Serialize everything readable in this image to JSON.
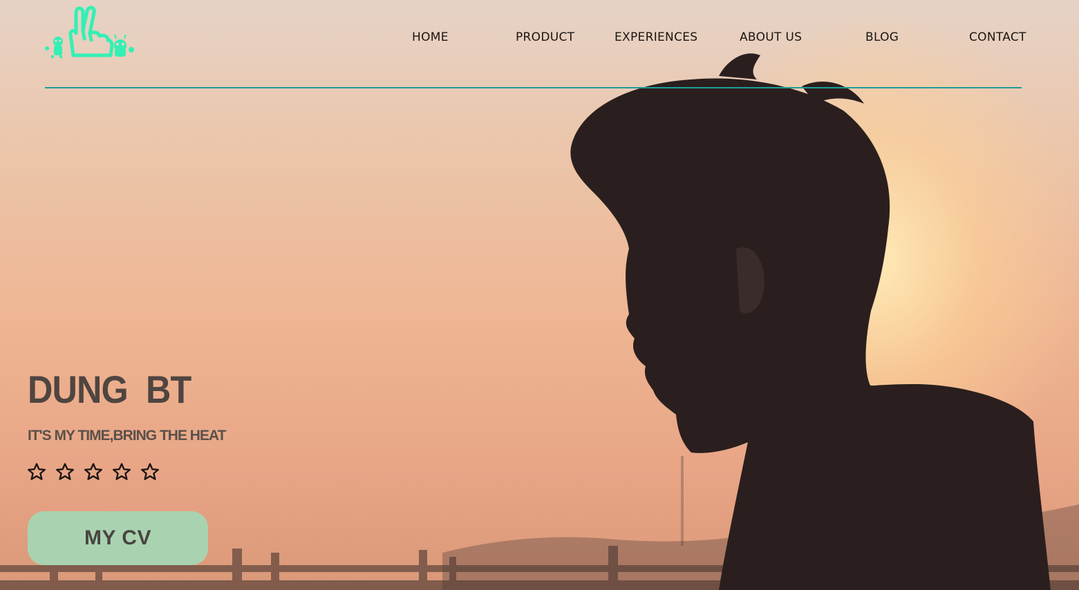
{
  "colors": {
    "accent": "#33f0b4",
    "divider": "#1b9d97",
    "nav_text": "#1b1512",
    "title_text": "#4f4540",
    "button_bg": "#a9d3b0",
    "button_text": "#4a4440"
  },
  "header": {
    "logo_icon": "peace-hand-logo-icon",
    "nav": [
      {
        "label": "HOME"
      },
      {
        "label": "PRODUCT"
      },
      {
        "label": "EXPERIENCES"
      },
      {
        "label": "ABOUT US"
      },
      {
        "label": "BLOG"
      },
      {
        "label": "CONTACT"
      }
    ]
  },
  "hero": {
    "name": "DUNG  BT",
    "tagline": "IT'S MY TIME,BRING THE HEAT",
    "rating": {
      "value": 0,
      "max": 5,
      "icon": "star-outline-icon"
    },
    "cta_label": "MY CV",
    "background": "sunset-silhouette-photo"
  }
}
